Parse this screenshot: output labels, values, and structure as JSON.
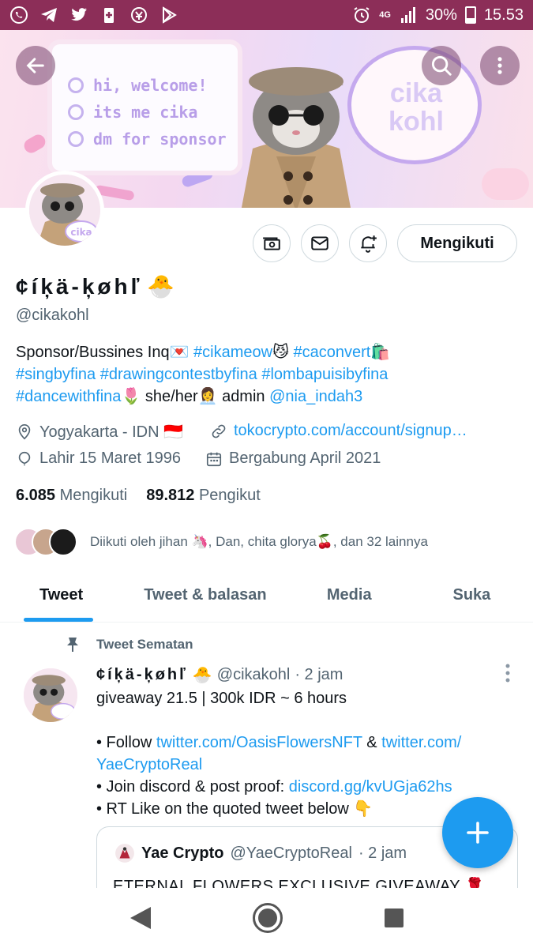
{
  "status_bar": {
    "network": "4G",
    "battery": "30%",
    "time": "15.53",
    "icons": [
      "whatsapp-icon",
      "telegram-icon",
      "twitter-icon",
      "battery-saver-icon",
      "vpn-icon",
      "play-store-icon"
    ]
  },
  "banner": {
    "lines": [
      "hi, welcome!",
      "its me cika",
      "dm for sponsor"
    ],
    "bubble_text": "cika kohl",
    "avatar_tag": "cika"
  },
  "profile": {
    "display_name": "¢íķä-ķøhľ",
    "name_emoji": "🐣",
    "handle": "@cikakohl",
    "follow_button": "Mengikuti",
    "bio": {
      "line1_text": "Sponsor/Bussines Inq💌 ",
      "line1_tag1": "#cikameow",
      "line1_emoji1": "😼 ",
      "line1_tag2": "#caconvert",
      "line1_emoji2": "🛍️",
      "line2_tag1": "#singbyfina",
      "line2_tag2": "#drawingcontestbyfina",
      "line2_tag3": "#lombapuisibyfina",
      "line3_tag": "#dancewithfina",
      "line3_text": "🌷 she/her👩‍💼 admin ",
      "line3_mention": "@nia_indah3"
    },
    "location": "Yogyakarta - IDN 🇮🇩",
    "website": "tokocrypto.com/account/signup…",
    "birthday": "Lahir 15 Maret 1996",
    "joined": "Bergabung April 2021",
    "following_count": "6.085",
    "following_label": "Mengikuti",
    "followers_count": "89.812",
    "followers_label": "Pengikut",
    "followed_by": "Diikuti oleh jihan 🦄, Dan, chita glorya🍒, dan 32 lainnya"
  },
  "tabs": [
    {
      "label": "Tweet",
      "active": true
    },
    {
      "label": "Tweet & balasan",
      "active": false
    },
    {
      "label": "Media",
      "active": false
    },
    {
      "label": "Suka",
      "active": false
    }
  ],
  "pinned_tweet": {
    "pin_label": "Tweet Sematan",
    "author_name": "¢íķä-ķøhľ",
    "author_emoji": "🐣",
    "author_handle": "@cikakohl",
    "time": "· 2 jam",
    "line1": "giveaway 21.5 | 300k IDR ~ 6 hours",
    "bullet1_prefix": "• Follow ",
    "bullet1_link1": "twitter.com/OasisFlowersNFT",
    "bullet1_amp": " & ",
    "bullet1_link2a": "twitter.com/",
    "bullet1_link2b": "YaeCryptoReal",
    "bullet2_prefix": "• Join discord & post proof: ",
    "bullet2_link": "discord.gg/kvUGja62hs",
    "bullet3": "• RT Like on the quoted tweet below 👇",
    "quote": {
      "author_name": "Yae Crypto",
      "author_handle": "@YaeCryptoReal",
      "time": "· 2 jam",
      "text": "ETERNAL FLOWERS EXCLUSIVE GIVEAWAY 🌹"
    }
  },
  "colors": {
    "status_bar": "#8c2e58",
    "link": "#1d9bf0",
    "secondary_text": "#536471",
    "fab": "#1d9bf0"
  }
}
